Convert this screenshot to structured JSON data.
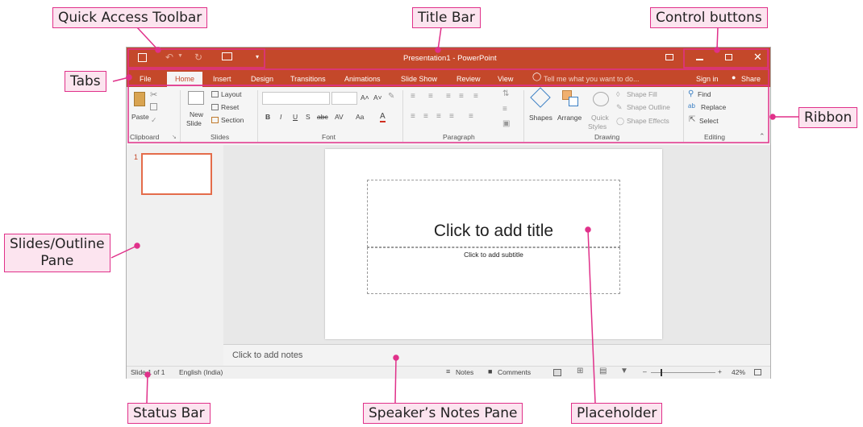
{
  "callouts": {
    "quick_access": "Quick Access Toolbar",
    "title_bar": "Title Bar",
    "control_buttons": "Control buttons",
    "tabs": "Tabs",
    "ribbon": "Ribbon",
    "slides_outline_line1": "Slides/Outline",
    "slides_outline_line2": "Pane",
    "status_bar": "Status Bar",
    "speaker_notes": "Speaker’s Notes Pane",
    "placeholder": "Placeholder"
  },
  "window": {
    "title": "Presentation1 - PowerPoint",
    "qat_more": "▾"
  },
  "tabs": [
    "File",
    "Home",
    "Insert",
    "Design",
    "Transitions",
    "Animations",
    "Slide Show",
    "Review",
    "View"
  ],
  "tell_me": "Tell me what you want to do...",
  "sign_in": "Sign in",
  "share": "Share",
  "ribbon": {
    "paste": "Paste",
    "new_slide_1": "New",
    "new_slide_2": "Slide",
    "layout": "Layout",
    "reset": "Reset",
    "section": "Section",
    "shapes": "Shapes",
    "arrange": "Arrange",
    "quick_styles_1": "Quick",
    "quick_styles_2": "Styles",
    "shape_fill": "Shape Fill",
    "shape_outline": "Shape Outline",
    "shape_effects": "Shape Effects",
    "find": "Find",
    "replace": "Replace",
    "select": "Select",
    "font_bold": "B",
    "font_italic": "I",
    "font_underline": "U",
    "font_shadow": "S",
    "font_strike": "abc",
    "font_spacing": "AV",
    "font_case": "Aa",
    "font_grow": "A˄",
    "font_shrink": "A˅",
    "font_color": "A",
    "groups": {
      "clipboard": "Clipboard",
      "slides": "Slides",
      "font": "Font",
      "paragraph": "Paragraph",
      "drawing": "Drawing",
      "editing": "Editing"
    }
  },
  "thumbnail_number": "1",
  "slide": {
    "title_placeholder": "Click to add title",
    "subtitle_placeholder": "Click to add subtitle"
  },
  "notes_placeholder": "Click to add notes",
  "status": {
    "slide_info": "Slide 1 of 1",
    "language": "English (India)",
    "notes": "Notes",
    "comments": "Comments",
    "zoom": "42%",
    "zoom_minus": "–",
    "zoom_plus": "+"
  },
  "colors": {
    "accent": "#c4482a",
    "callout_border": "#e0318a",
    "callout_fill": "#fce4ef",
    "thumbnail_border": "#e46c4a"
  }
}
